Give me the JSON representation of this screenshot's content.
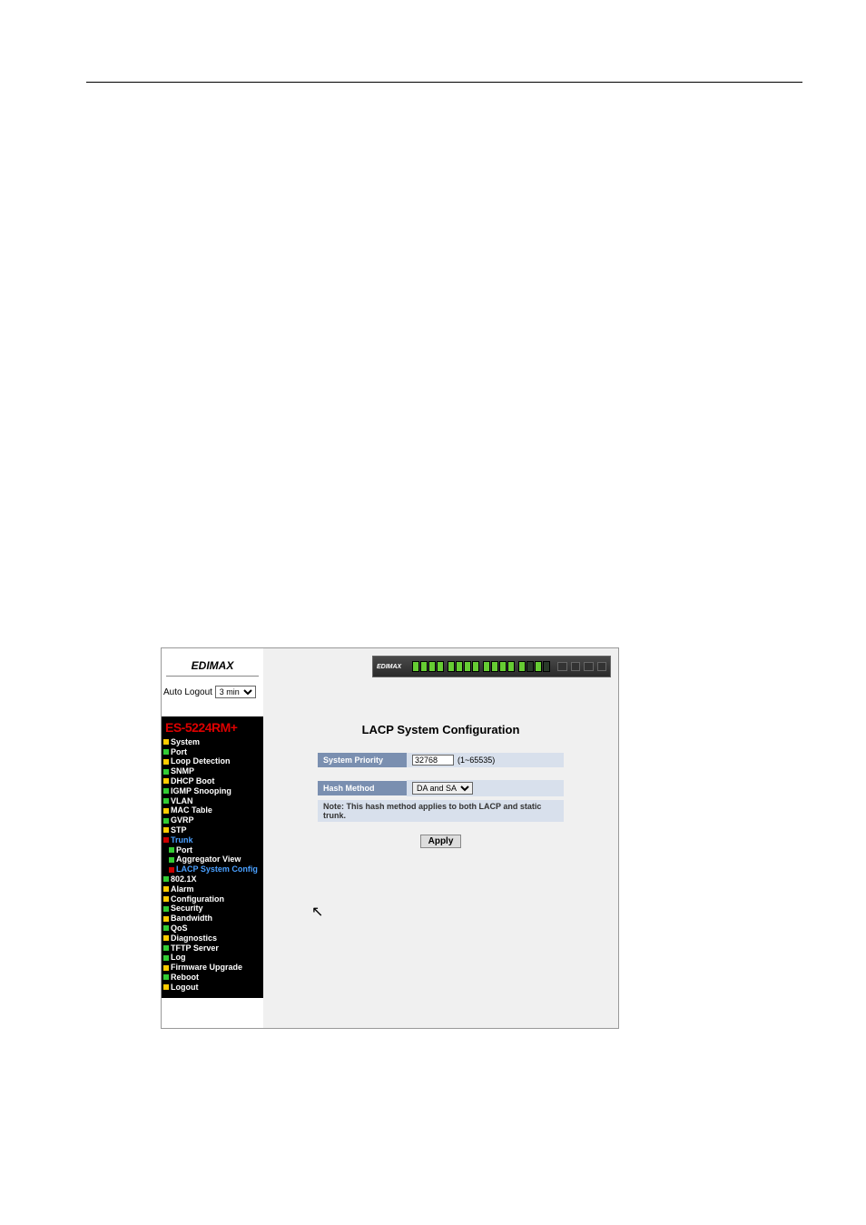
{
  "brand": "EDIMAX",
  "auto_logout": {
    "label": "Auto Logout",
    "selected": "3 min"
  },
  "nav": {
    "title": "ES-5224RM+",
    "items": [
      {
        "label": "System",
        "cls": "",
        "sq": "sq-yellow"
      },
      {
        "label": "Port",
        "cls": "",
        "sq": "sq-green"
      },
      {
        "label": "Loop Detection",
        "cls": "",
        "sq": "sq-yellow"
      },
      {
        "label": "SNMP",
        "cls": "",
        "sq": "sq-green"
      },
      {
        "label": "DHCP Boot",
        "cls": "",
        "sq": "sq-yellow"
      },
      {
        "label": "IGMP Snooping",
        "cls": "",
        "sq": "sq-green"
      },
      {
        "label": "VLAN",
        "cls": "",
        "sq": "sq-green"
      },
      {
        "label": "MAC Table",
        "cls": "",
        "sq": "sq-yellow"
      },
      {
        "label": "GVRP",
        "cls": "",
        "sq": "sq-green"
      },
      {
        "label": "STP",
        "cls": "",
        "sq": "sq-yellow"
      },
      {
        "label": "Trunk",
        "cls": "highlight",
        "sq": "sq-red"
      },
      {
        "label": "Port",
        "cls": "sub",
        "sq": "sq-green"
      },
      {
        "label": "Aggregator View",
        "cls": "sub",
        "sq": "sq-green"
      },
      {
        "label": "LACP System Config",
        "cls": "sub active",
        "sq": "sq-red"
      },
      {
        "label": "802.1X",
        "cls": "",
        "sq": "sq-green"
      },
      {
        "label": "Alarm",
        "cls": "",
        "sq": "sq-yellow"
      },
      {
        "label": "Configuration",
        "cls": "",
        "sq": "sq-yellow"
      },
      {
        "label": "Security",
        "cls": "",
        "sq": "sq-green"
      },
      {
        "label": "Bandwidth",
        "cls": "",
        "sq": "sq-yellow"
      },
      {
        "label": "QoS",
        "cls": "",
        "sq": "sq-green"
      },
      {
        "label": "Diagnostics",
        "cls": "",
        "sq": "sq-yellow"
      },
      {
        "label": "TFTP Server",
        "cls": "",
        "sq": "sq-green"
      },
      {
        "label": "Log",
        "cls": "",
        "sq": "sq-green"
      },
      {
        "label": "Firmware Upgrade",
        "cls": "",
        "sq": "sq-yellow"
      },
      {
        "label": "Reboot",
        "cls": "",
        "sq": "sq-green"
      },
      {
        "label": "Logout",
        "cls": "",
        "sq": "sq-yellow"
      }
    ]
  },
  "page": {
    "title": "LACP System Configuration",
    "priority_label": "System Priority",
    "priority_value": "32768",
    "priority_hint": "(1~65535)",
    "hash_label": "Hash Method",
    "hash_value": "DA and SA",
    "note": "Note: This hash method applies to both LACP and static trunk.",
    "apply": "Apply"
  }
}
